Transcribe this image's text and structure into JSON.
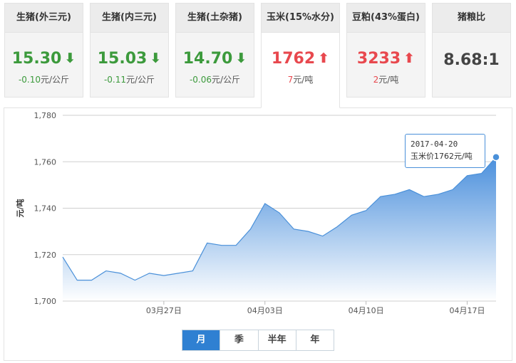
{
  "cards": [
    {
      "title": "生猪(外三元)",
      "value": "15.30",
      "trend": "down",
      "arrow": "⬇",
      "change_value": "-0.10",
      "change_unit": "元/公斤"
    },
    {
      "title": "生猪(内三元)",
      "value": "15.03",
      "trend": "down",
      "arrow": "⬇",
      "change_value": "-0.11",
      "change_unit": "元/公斤"
    },
    {
      "title": "生猪(土杂猪)",
      "value": "14.70",
      "trend": "down",
      "arrow": "⬇",
      "change_value": "-0.06",
      "change_unit": "元/公斤"
    },
    {
      "title": "玉米(15%水分)",
      "value": "1762",
      "trend": "up",
      "arrow": "⬆",
      "change_value": "7",
      "change_unit": "元/吨"
    },
    {
      "title": "豆粕(43%蛋白)",
      "value": "3233",
      "trend": "up",
      "arrow": "⬆",
      "change_value": "2",
      "change_unit": "元/吨"
    },
    {
      "title": "猪粮比",
      "value": "8.68:1",
      "trend": "flat",
      "arrow": "",
      "change_value": "",
      "change_unit": ""
    }
  ],
  "active_card": 3,
  "tooltip": {
    "date": "2017-04-20",
    "text": "玉米价1762元/吨"
  },
  "range_tabs": [
    "月",
    "季",
    "半年",
    "年"
  ],
  "active_range": 0,
  "colors": {
    "line": "#4a90d9",
    "area_top": "#4a8fdc",
    "area_bottom": "#ffffff",
    "up": "#e8484e",
    "down": "#3c9a3c",
    "tab_active": "#2f80d2"
  },
  "chart_data": {
    "type": "area",
    "ylabel": "元/吨",
    "ylim": [
      1700,
      1780
    ],
    "yticks": [
      1700,
      1720,
      1740,
      1760,
      1780
    ],
    "ytick_labels": [
      "1,700",
      "1,720",
      "1,740",
      "1,760",
      "1,780"
    ],
    "xtick_labels": [
      "03月27日",
      "04月03日",
      "04月10日",
      "04月17日"
    ],
    "xtick_positions": [
      7,
      14,
      21,
      28
    ],
    "grid": true,
    "series": [
      {
        "values": [
          1719,
          1709,
          1709,
          1713,
          1712,
          1709,
          1712,
          1711,
          1712,
          1713,
          1725,
          1724,
          1724,
          1731,
          1742,
          1738,
          1731,
          1730,
          1728,
          1732,
          1737,
          1739,
          1745,
          1746,
          1748,
          1745,
          1746,
          1748,
          1754,
          1755,
          1762
        ]
      }
    ],
    "highlight_index": 30
  }
}
